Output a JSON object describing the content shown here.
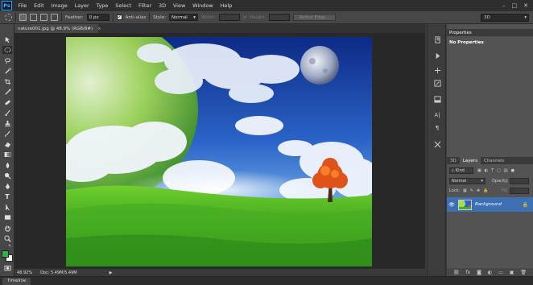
{
  "app": {
    "logo": "Ps"
  },
  "menu": [
    "File",
    "Edit",
    "Image",
    "Layer",
    "Type",
    "Select",
    "Filter",
    "3D",
    "View",
    "Window",
    "Help"
  ],
  "window_controls": {
    "minimize": "–",
    "maximize": "□",
    "close": "✕"
  },
  "options": {
    "feather_label": "Feather:",
    "feather_value": "0 px",
    "antialias_label": "Anti-alias",
    "antialias_checked": "✓",
    "style_label": "Style:",
    "style_value": "Normal",
    "width_label": "Width:",
    "height_label": "Height:",
    "refine_edge_label": "Refine Edge...",
    "workspace_value": "3D"
  },
  "document": {
    "tab_title": "nature001.jpg @ 48.9% (RGB/8#)",
    "tab_close": "×"
  },
  "status": {
    "zoom": "48.92%",
    "doc_info": "Doc: 5.49M/5.49M",
    "arrow": "▶"
  },
  "timeline": {
    "label": "Timeline"
  },
  "properties": {
    "header": "Properties",
    "empty_text": "No Properties"
  },
  "layers_panel": {
    "tabs": [
      "3D",
      "Layers",
      "Channels"
    ],
    "filter_label": "Kind",
    "blend_mode": "Normal",
    "opacity_label": "Opacity:",
    "lock_label": "Lock:",
    "fill_label": "Fill:",
    "layer_name": "Background"
  },
  "colors": {
    "foreground": "#2bb34a",
    "background": "#ffffff",
    "selected_layer": "#3d6fb3"
  }
}
